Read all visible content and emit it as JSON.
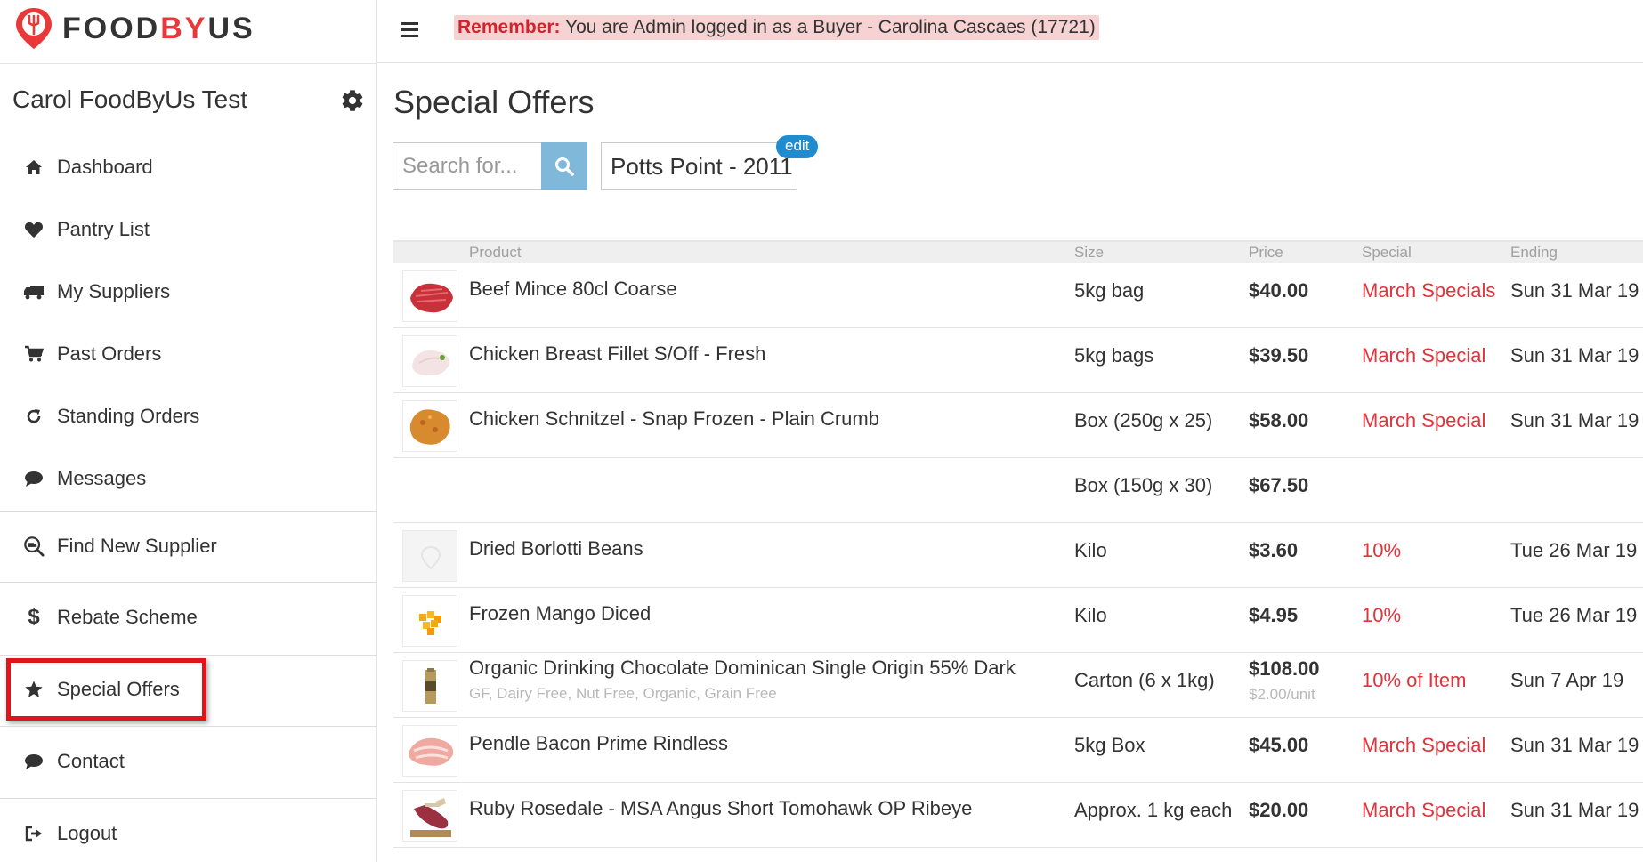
{
  "logo": {
    "part1": "FOOD",
    "part2": "BY",
    "part3": "US",
    "icon": "fork-pin-icon",
    "brand_color": "#e8383a"
  },
  "header": {
    "menu_icon": "hamburger-icon",
    "notice_bold": "Remember:",
    "notice_text": " You are Admin logged in as a Buyer - Carolina Cascaes (17721)"
  },
  "sidebar": {
    "user_name": "Carol FoodByUs Test",
    "settings_icon": "gear-icon",
    "items": [
      {
        "label": "Dashboard",
        "icon": "home-icon"
      },
      {
        "label": "Pantry List",
        "icon": "heart-icon"
      },
      {
        "label": "My Suppliers",
        "icon": "truck-icon"
      },
      {
        "label": "Past Orders",
        "icon": "cart-icon"
      },
      {
        "label": "Standing Orders",
        "icon": "refresh-icon"
      },
      {
        "label": "Messages",
        "icon": "chat-icon"
      },
      {
        "label": "Find New Supplier",
        "icon": "search-supplier-icon"
      },
      {
        "label": "Rebate Scheme",
        "icon": "dollar-icon"
      },
      {
        "label": "Special Offers",
        "icon": "star-icon"
      },
      {
        "label": "Contact",
        "icon": "chat-icon"
      },
      {
        "label": "Logout",
        "icon": "logout-icon"
      }
    ]
  },
  "main": {
    "title": "Special Offers",
    "search_placeholder": "Search for...",
    "location": "Potts Point - 2011",
    "edit_label": "edit"
  },
  "table": {
    "headers": {
      "product": "Product",
      "size": "Size",
      "price": "Price",
      "special": "Special",
      "ending": "Ending"
    },
    "rows": [
      {
        "product": "Beef Mince 80cl Coarse",
        "tags": "",
        "size": "5kg bag",
        "price": "$40.00",
        "unit": "",
        "special": "March Specials",
        "ending": "Sun 31 Mar 19",
        "thumb": "beef-mince"
      },
      {
        "product": "Chicken Breast Fillet S/Off - Fresh",
        "tags": "",
        "size": "5kg bags",
        "price": "$39.50",
        "unit": "",
        "special": "March Special",
        "ending": "Sun 31 Mar 19",
        "thumb": "chicken-breast"
      },
      {
        "product": "Chicken Schnitzel - Snap Frozen - Plain Crumb",
        "tags": "",
        "size": "Box (250g x 25)",
        "price": "$58.00",
        "unit": "",
        "special": "March Special",
        "ending": "Sun 31 Mar 19",
        "thumb": "schnitzel"
      },
      {
        "product": "",
        "tags": "",
        "size": "Box (150g x 30)",
        "price": "$67.50",
        "unit": "",
        "special": "",
        "ending": "",
        "thumb": ""
      },
      {
        "product": "Dried Borlotti Beans",
        "tags": "",
        "size": "Kilo",
        "price": "$3.60",
        "unit": "",
        "special": "10%",
        "ending": "Tue 26 Mar 19",
        "thumb": "placeholder"
      },
      {
        "product": "Frozen Mango Diced",
        "tags": "",
        "size": "Kilo",
        "price": "$4.95",
        "unit": "",
        "special": "10%",
        "ending": "Tue 26 Mar 19",
        "thumb": "mango"
      },
      {
        "product": "Organic Drinking Chocolate Dominican Single Origin 55% Dark",
        "tags": "GF, Dairy Free, Nut Free, Organic, Grain Free",
        "size": "Carton (6 x 1kg)",
        "price": "$108.00",
        "unit": "$2.00/unit",
        "special": "10% of Item",
        "ending": "Sun 7 Apr 19",
        "thumb": "chocolate"
      },
      {
        "product": "Pendle Bacon Prime Rindless",
        "tags": "",
        "size": "5kg Box",
        "price": "$45.00",
        "unit": "",
        "special": "March Special",
        "ending": "Sun 31 Mar 19",
        "thumb": "bacon"
      },
      {
        "product": "Ruby Rosedale - MSA Angus Short Tomohawk OP Ribeye",
        "tags": "",
        "size": "Approx. 1 kg each",
        "price": "$20.00",
        "unit": "",
        "special": "March Special",
        "ending": "Sun 31 Mar 19",
        "thumb": "ribeye"
      }
    ]
  }
}
